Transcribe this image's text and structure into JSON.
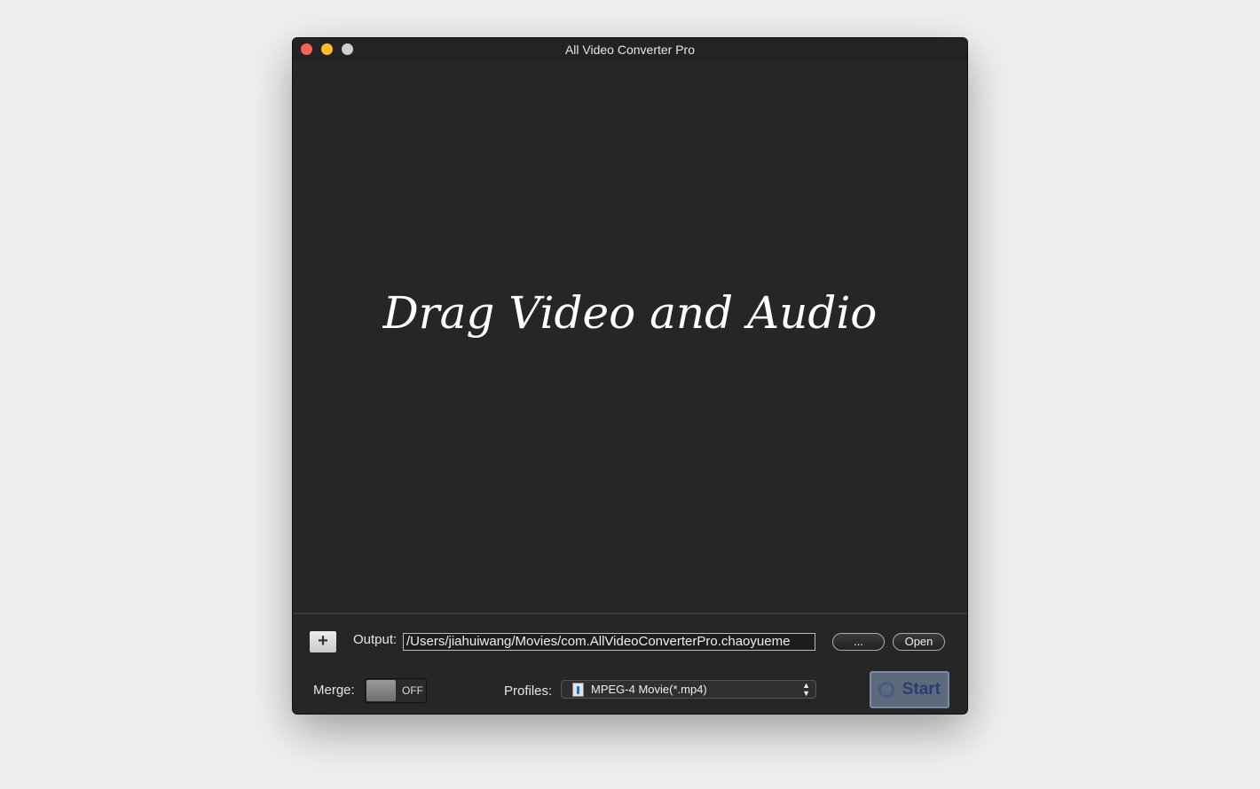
{
  "window": {
    "title": "All Video Converter Pro"
  },
  "dropzone": {
    "text": "Drag Video and Audio"
  },
  "bottom": {
    "add_icon": "plus-icon",
    "output_label": "Output:",
    "output_value": "/Users/jiahuiwang/Movies/com.AllVideoConverterPro.chaoyueme",
    "browse_label": "...",
    "open_label": "Open",
    "merge_label": "Merge:",
    "merge_state": "OFF",
    "profiles_label": "Profiles:",
    "profile_value": "MPEG-4 Movie(*.mp4)",
    "start_label": "Start"
  },
  "colors": {
    "close": "#fe5f57",
    "minimize": "#febc2e",
    "zoom": "#cfcfcf"
  }
}
